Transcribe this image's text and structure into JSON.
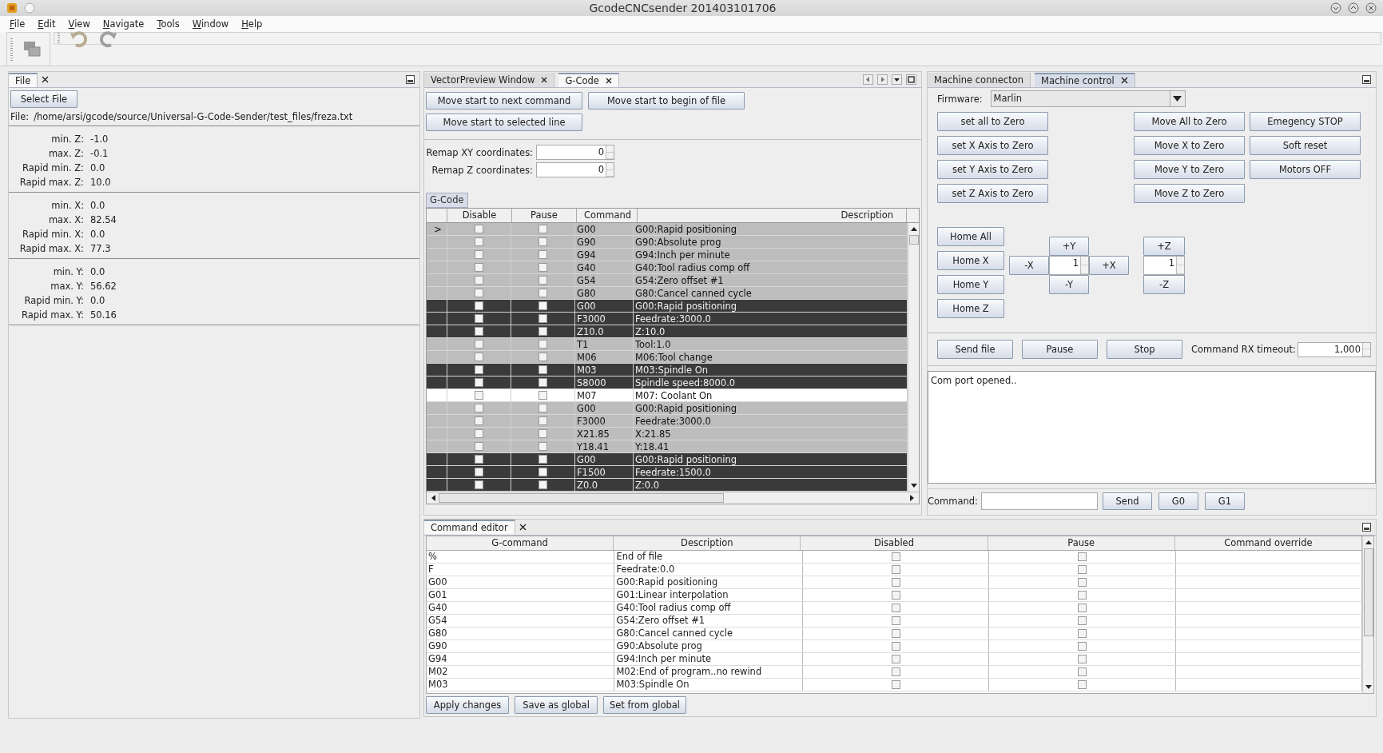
{
  "window": {
    "title": "GcodeCNCsender 201403101706"
  },
  "menu": [
    "File",
    "Edit",
    "View",
    "Navigate",
    "Tools",
    "Window",
    "Help"
  ],
  "file_panel": {
    "tab": "File",
    "select_button": "Select File",
    "file_label": "File:",
    "file_path": "/home/arsi/gcode/source/Universal-G-Code-Sender/test_files/freza.txt",
    "stats": [
      [
        {
          "label": "min. Z:",
          "value": "-1.0"
        },
        {
          "label": "max. Z:",
          "value": "-0.1"
        },
        {
          "label": "Rapid min. Z:",
          "value": "0.0"
        },
        {
          "label": "Rapid max. Z:",
          "value": "10.0"
        }
      ],
      [
        {
          "label": "min. X:",
          "value": "0.0"
        },
        {
          "label": "max. X:",
          "value": "82.54"
        },
        {
          "label": "Rapid min. X:",
          "value": "0.0"
        },
        {
          "label": "Rapid max. X:",
          "value": "77.3"
        }
      ],
      [
        {
          "label": "min. Y:",
          "value": "0.0"
        },
        {
          "label": "max. Y:",
          "value": "56.62"
        },
        {
          "label": "Rapid min. Y:",
          "value": "0.0"
        },
        {
          "label": "Rapid max. Y:",
          "value": "50.16"
        }
      ]
    ]
  },
  "gcode_panel": {
    "tabs": [
      {
        "label": "VectorPreview Window",
        "selected": false
      },
      {
        "label": "G-Code",
        "selected": true
      }
    ],
    "buttons": [
      "Move start to next command",
      "Move start to begin of file",
      "Move start to selected line"
    ],
    "remap": [
      {
        "label": "Remap XY coordinates:",
        "value": "0"
      },
      {
        "label": "Remap Z coordinates:",
        "value": "0"
      }
    ],
    "table_tab": "G-Code",
    "columns": [
      "Disable",
      "Pause",
      "Command",
      "Description"
    ],
    "rows": [
      {
        "marker": ">",
        "disable": false,
        "pause": false,
        "command": "G00",
        "description": "G00:Rapid positioning",
        "selected": false,
        "sent": true
      },
      {
        "disable": false,
        "pause": false,
        "command": "G90",
        "description": "G90:Absolute prog",
        "selected": false,
        "sent": true
      },
      {
        "disable": false,
        "pause": false,
        "command": "G94",
        "description": "G94:Inch per minute",
        "selected": false,
        "sent": true
      },
      {
        "disable": false,
        "pause": false,
        "command": "G40",
        "description": "G40:Tool radius comp off",
        "selected": false,
        "sent": true
      },
      {
        "disable": false,
        "pause": false,
        "command": "G54",
        "description": "G54:Zero offset #1",
        "selected": false,
        "sent": true
      },
      {
        "disable": false,
        "pause": false,
        "command": "G80",
        "description": "G80:Cancel canned cycle",
        "selected": false,
        "sent": true
      },
      {
        "disable": false,
        "pause": false,
        "command": "G00",
        "description": "G00:Rapid positioning",
        "selected": true,
        "sent": true
      },
      {
        "disable": false,
        "pause": false,
        "command": "F3000",
        "description": "Feedrate:3000.0",
        "selected": true,
        "sent": true
      },
      {
        "disable": false,
        "pause": false,
        "command": "Z10.0",
        "description": "Z:10.0",
        "selected": true,
        "sent": true
      },
      {
        "disable": false,
        "pause": false,
        "command": "T1",
        "description": "Tool:1.0",
        "selected": false,
        "sent": true
      },
      {
        "disable": false,
        "pause": false,
        "command": "M06",
        "description": "M06:Tool change",
        "selected": false,
        "sent": true
      },
      {
        "disable": false,
        "pause": false,
        "command": "M03",
        "description": "M03:Spindle On",
        "selected": true,
        "sent": true
      },
      {
        "disable": false,
        "pause": false,
        "command": "S8000",
        "description": "Spindle speed:8000.0",
        "selected": true,
        "sent": true
      },
      {
        "disable": false,
        "pause": false,
        "command": "M07",
        "description": "M07:  Coolant On",
        "selected": false,
        "sent": false
      },
      {
        "disable": false,
        "pause": false,
        "command": "G00",
        "description": "G00:Rapid positioning",
        "selected": false,
        "sent": true
      },
      {
        "disable": false,
        "pause": false,
        "command": "F3000",
        "description": "Feedrate:3000.0",
        "selected": false,
        "sent": true
      },
      {
        "disable": false,
        "pause": false,
        "command": "X21.85",
        "description": "X:21.85",
        "selected": false,
        "sent": true
      },
      {
        "disable": false,
        "pause": false,
        "command": "Y18.41",
        "description": "Y:18.41",
        "selected": false,
        "sent": true
      },
      {
        "disable": false,
        "pause": false,
        "command": "G00",
        "description": "G00:Rapid positioning",
        "selected": true,
        "sent": true
      },
      {
        "disable": false,
        "pause": false,
        "command": "F1500",
        "description": "Feedrate:1500.0",
        "selected": true,
        "sent": true
      },
      {
        "disable": false,
        "pause": false,
        "command": "Z0.0",
        "description": "Z:0.0",
        "selected": true,
        "sent": true
      }
    ]
  },
  "control_panel": {
    "tabs": [
      {
        "label": "Machine connecton",
        "selected": false
      },
      {
        "label": "Machine control",
        "selected": true
      }
    ],
    "firmware_label": "Firmware:",
    "firmware": "Marlin",
    "zero_buttons": [
      "set all to Zero",
      "set X Axis to Zero",
      "set Y Axis to Zero",
      "set Z Axis to Zero"
    ],
    "move_buttons": [
      "Move All to Zero",
      "Move X to Zero",
      "Move Y to Zero",
      "Move Z to Zero"
    ],
    "machine_buttons": [
      "Emegency STOP",
      "Soft reset",
      "Motors OFF"
    ],
    "home_buttons": [
      "Home All",
      "Home X",
      "Home Y",
      "Home Z"
    ],
    "jog_xy": {
      "plus_y": "+Y",
      "minus_x": "-X",
      "step": "1",
      "plus_x": "+X",
      "minus_y": "-Y"
    },
    "jog_z": {
      "plus_z": "+Z",
      "step": "1",
      "minus_z": "-Z"
    },
    "send_buttons": [
      "Send file",
      "Pause",
      "Stop"
    ],
    "timeout_label": "Command RX timeout:",
    "timeout": "1,000",
    "console": "Com port opened..",
    "command_label": "Command:",
    "command_buttons": [
      "Send",
      "G0",
      "G1"
    ]
  },
  "command_editor": {
    "tab": "Command editor",
    "columns": [
      "G-command",
      "Description",
      "Disabled",
      "Pause",
      "Command override"
    ],
    "rows": [
      {
        "command": "%",
        "description": "End of file",
        "disabled": false,
        "pause": false
      },
      {
        "command": "F",
        "description": "Feedrate:0.0",
        "disabled": false,
        "pause": false
      },
      {
        "command": "G00",
        "description": "G00:Rapid positioning",
        "disabled": false,
        "pause": false
      },
      {
        "command": "G01",
        "description": "G01:Linear interpolation",
        "disabled": false,
        "pause": false
      },
      {
        "command": "G40",
        "description": "G40:Tool radius comp off",
        "disabled": false,
        "pause": false
      },
      {
        "command": "G54",
        "description": "G54:Zero offset #1",
        "disabled": false,
        "pause": false
      },
      {
        "command": "G80",
        "description": "G80:Cancel canned cycle",
        "disabled": false,
        "pause": false
      },
      {
        "command": "G90",
        "description": "G90:Absolute prog",
        "disabled": false,
        "pause": false
      },
      {
        "command": "G94",
        "description": "G94:Inch per minute",
        "disabled": false,
        "pause": false
      },
      {
        "command": "M02",
        "description": "M02:End of program..no rewind",
        "disabled": false,
        "pause": false
      },
      {
        "command": "M03",
        "description": "M03:Spindle On",
        "disabled": false,
        "pause": false
      }
    ],
    "buttons": [
      "Apply changes",
      "Save as global",
      "Set from global"
    ]
  }
}
